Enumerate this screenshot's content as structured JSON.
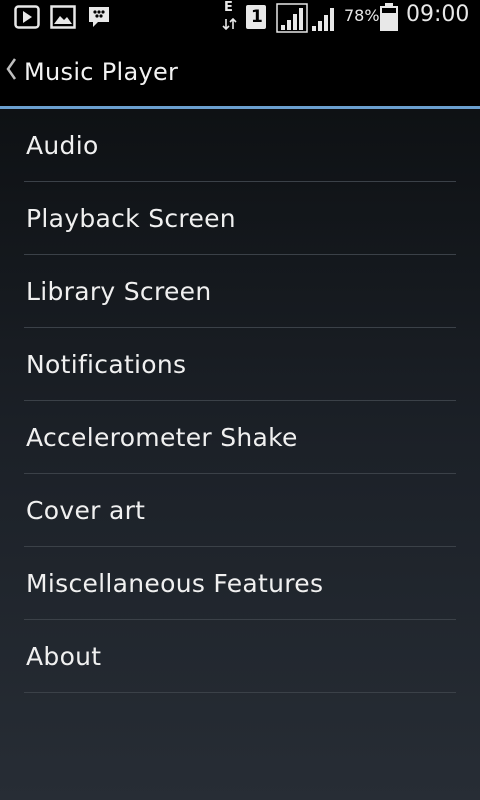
{
  "status_bar": {
    "icons": [
      "play-notification-icon",
      "gallery-notification-icon",
      "bbm-notification-icon",
      "data-e-icon",
      "sim-1-icon",
      "signal-icon",
      "signal-icon",
      "battery-icon"
    ],
    "network_type": "E",
    "sim_slot": "1",
    "battery_percent": "78%",
    "battery_level": 0.78,
    "time": "09:00"
  },
  "action_bar": {
    "title": "Music Player",
    "back_icon": "chevron-left-icon",
    "divider_color": "#6a9fcf"
  },
  "settings": {
    "items": [
      {
        "label": "Audio"
      },
      {
        "label": "Playback Screen"
      },
      {
        "label": "Library Screen"
      },
      {
        "label": "Notifications"
      },
      {
        "label": "Accelerometer Shake"
      },
      {
        "label": "Cover art"
      },
      {
        "label": "Miscellaneous Features"
      },
      {
        "label": "About"
      }
    ]
  }
}
